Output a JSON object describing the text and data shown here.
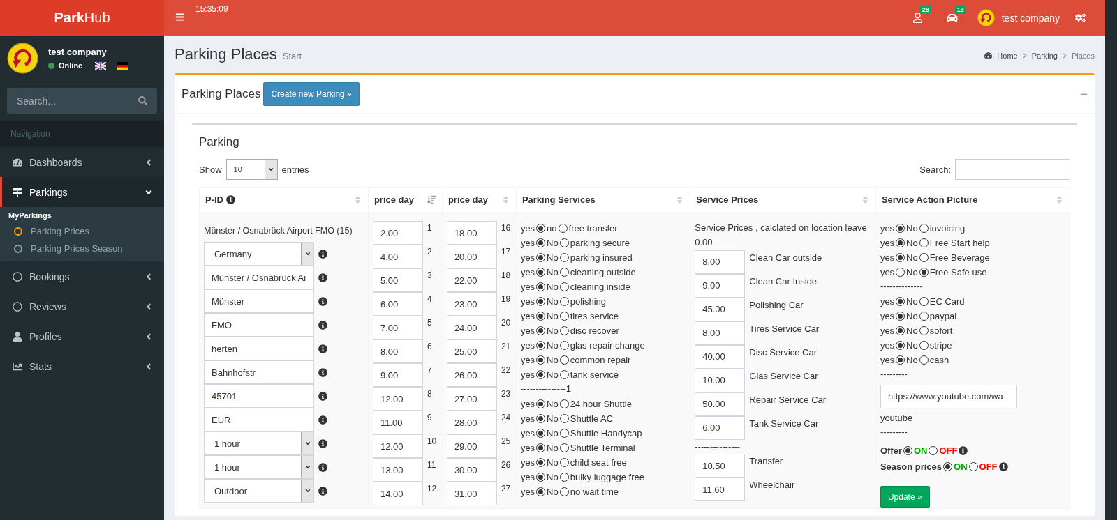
{
  "brand": {
    "bold": "Park",
    "light": "Hub"
  },
  "user": {
    "name": "test company",
    "status": "Online",
    "online": true
  },
  "sidebar": {
    "search_placeholder": "Search...",
    "section": "Navigation",
    "items": [
      {
        "kind": "dashboard",
        "label": "Dashboards",
        "expanded": false,
        "selected": false
      },
      {
        "kind": "signs",
        "label": "Parkings",
        "expanded": true,
        "selected": true,
        "heading": "MyParkings",
        "children": [
          {
            "label": "Parking Prices",
            "selected": true
          },
          {
            "label": "Parking Prices Season",
            "selected": false
          }
        ]
      },
      {
        "kind": "circle",
        "label": "Bookings",
        "expanded": false,
        "selected": false
      },
      {
        "kind": "circle",
        "label": "Reviews",
        "expanded": false,
        "selected": false
      },
      {
        "kind": "user",
        "label": "Profiles",
        "expanded": false,
        "selected": false
      },
      {
        "kind": "chart",
        "label": "Stats",
        "expanded": false,
        "selected": false
      }
    ]
  },
  "header": {
    "time": "15:35:09",
    "notifications": [
      {
        "kind": "user",
        "count": "28"
      },
      {
        "kind": "car",
        "count": "13"
      }
    ],
    "user_name": "test company"
  },
  "page": {
    "title": "Parking Places",
    "subtitle": "Start",
    "breadcrumb": [
      "Home",
      "Parking",
      "Places"
    ]
  },
  "box": {
    "title": "Parking Places",
    "button": "Create new Parking »"
  },
  "panel": {
    "title": "Parking",
    "show_label": "Show",
    "length": "10",
    "entries_label": "entries",
    "search_label": "Search:"
  },
  "columns": [
    {
      "label": "P-ID",
      "info": true,
      "sorted": false
    },
    {
      "label": "price day",
      "info": false,
      "sorted": true
    },
    {
      "label": "price day",
      "info": false,
      "sorted": false
    },
    {
      "label": "Parking Services",
      "info": false,
      "sorted": false
    },
    {
      "label": "Service Prices",
      "info": false,
      "sorted": false
    },
    {
      "label": "Service Action Picture",
      "info": false,
      "sorted": false
    }
  ],
  "pid": {
    "title": "Münster / Osnabrück Airport FMO (15)",
    "fields": [
      {
        "kind": "select",
        "value": "Germany"
      },
      {
        "kind": "text",
        "value": "Münster / Osnabrück Ai"
      },
      {
        "kind": "text",
        "value": "Münster"
      },
      {
        "kind": "text",
        "value": "FMO"
      },
      {
        "kind": "text",
        "value": "herten"
      },
      {
        "kind": "text",
        "value": "Bahnhofstr"
      },
      {
        "kind": "text",
        "value": "45701"
      },
      {
        "kind": "text",
        "value": "EUR"
      },
      {
        "kind": "select",
        "value": "1 hour"
      },
      {
        "kind": "select",
        "value": "1 hour"
      },
      {
        "kind": "select",
        "value": "Outdoor"
      }
    ]
  },
  "prices_a": [
    {
      "value": "2.00",
      "day": "1"
    },
    {
      "value": "4.00",
      "day": "2"
    },
    {
      "value": "5.00",
      "day": "3"
    },
    {
      "value": "6.00",
      "day": "4"
    },
    {
      "value": "7.00",
      "day": "5"
    },
    {
      "value": "8.00",
      "day": "6"
    },
    {
      "value": "9.00",
      "day": "7"
    },
    {
      "value": "12.00",
      "day": "8"
    },
    {
      "value": "11.00",
      "day": "9"
    },
    {
      "value": "12.00",
      "day": "10"
    },
    {
      "value": "13.00",
      "day": "11"
    },
    {
      "value": "14.00",
      "day": "12"
    }
  ],
  "prices_b": [
    {
      "value": "18.00",
      "day": "16"
    },
    {
      "value": "20.00",
      "day": "17"
    },
    {
      "value": "22.00",
      "day": "18"
    },
    {
      "value": "23.00",
      "day": "19"
    },
    {
      "value": "24.00",
      "day": "20"
    },
    {
      "value": "25.00",
      "day": "21"
    },
    {
      "value": "26.00",
      "day": "22"
    },
    {
      "value": "27.00",
      "day": "23"
    },
    {
      "value": "28.00",
      "day": "24"
    },
    {
      "value": "29.00",
      "day": "25"
    },
    {
      "value": "30.00",
      "day": "26"
    },
    {
      "value": "31.00",
      "day": "27"
    }
  ],
  "services": [
    {
      "kind": "option",
      "yes_text": "yes",
      "no_text": "no",
      "label": "free transfer",
      "yes": true
    },
    {
      "kind": "option",
      "yes_text": "yes",
      "no_text": "No",
      "label": "parking secure",
      "yes": true
    },
    {
      "kind": "option",
      "yes_text": "yes",
      "no_text": "No",
      "label": "parking insured",
      "yes": true
    },
    {
      "kind": "option",
      "yes_text": "yes",
      "no_text": "No",
      "label": "cleaning outside",
      "yes": true
    },
    {
      "kind": "option",
      "yes_text": "yes",
      "no_text": "No",
      "label": "cleaning inside",
      "yes": true
    },
    {
      "kind": "option",
      "yes_text": "yes",
      "no_text": "No",
      "label": "polishing",
      "yes": true
    },
    {
      "kind": "option",
      "yes_text": "yes",
      "no_text": "No",
      "label": "tires service",
      "yes": true
    },
    {
      "kind": "option",
      "yes_text": "yes",
      "no_text": "No",
      "label": "disc recover",
      "yes": true
    },
    {
      "kind": "option",
      "yes_text": "yes",
      "no_text": "No",
      "label": "glas repair change",
      "yes": true
    },
    {
      "kind": "option",
      "yes_text": "yes",
      "no_text": "No",
      "label": "common repair",
      "yes": true
    },
    {
      "kind": "option",
      "yes_text": "yes",
      "no_text": "No",
      "label": "tank service",
      "yes": true
    },
    {
      "kind": "separator",
      "text": "---------------1"
    },
    {
      "kind": "option",
      "yes_text": "yes",
      "no_text": "No",
      "label": "24 hour Shuttle",
      "yes": true
    },
    {
      "kind": "option",
      "yes_text": "yes",
      "no_text": "No",
      "label": "Shuttle AC",
      "yes": true
    },
    {
      "kind": "option",
      "yes_text": "yes",
      "no_text": "No",
      "label": "Shuttle Handycap",
      "yes": true
    },
    {
      "kind": "option",
      "yes_text": "yes",
      "no_text": "No",
      "label": "Shuttle Terminal",
      "yes": true
    },
    {
      "kind": "option",
      "yes_text": "yes",
      "no_text": "No",
      "label": "child seat free",
      "yes": true
    },
    {
      "kind": "option",
      "yes_text": "yes",
      "no_text": "No",
      "label": "bulky luggage free",
      "yes": true
    },
    {
      "kind": "option",
      "yes_text": "yes",
      "no_text": "No",
      "label": "no wait time",
      "yes": true
    }
  ],
  "service_prices": {
    "note": "Service Prices , calclated on location leave",
    "total": "0.00",
    "items": [
      {
        "kind": "price",
        "value": "8.00",
        "label": "Clean Car outside"
      },
      {
        "kind": "price",
        "value": "9.00",
        "label": "Clean Car Inside"
      },
      {
        "kind": "price",
        "value": "45.00",
        "label": "Polishing Car"
      },
      {
        "kind": "price",
        "value": "8.00",
        "label": "Tires Service Car"
      },
      {
        "kind": "price",
        "value": "40.00",
        "label": "Disc Service Car"
      },
      {
        "kind": "price",
        "value": "10.00",
        "label": "Glas Service Car"
      },
      {
        "kind": "price",
        "value": "50.00",
        "label": "Repair Service Car"
      },
      {
        "kind": "price",
        "value": "6.00",
        "label": "Tank Service Car"
      },
      {
        "kind": "separator",
        "text": "---------------"
      },
      {
        "kind": "price",
        "value": "10.50",
        "label": "Transfer"
      },
      {
        "kind": "price",
        "value": "11.60",
        "label": "Wheelchair"
      }
    ]
  },
  "action": {
    "items": [
      {
        "kind": "option",
        "yes_text": "yes",
        "no_text": "No",
        "label": "invoicing",
        "yes": true
      },
      {
        "kind": "option",
        "yes_text": "yes",
        "no_text": "No",
        "label": "Free Start help",
        "yes": true
      },
      {
        "kind": "option",
        "yes_text": "yes",
        "no_text": "No",
        "label": "Free Beverage",
        "yes": true
      },
      {
        "kind": "option",
        "yes_text": "yes",
        "no_text": "No",
        "label": "Free Safe use",
        "yes": false
      },
      {
        "kind": "separator",
        "text": "--------------"
      },
      {
        "kind": "option",
        "yes_text": "yes",
        "no_text": "No",
        "label": "EC Card",
        "yes": true
      },
      {
        "kind": "option",
        "yes_text": "yes",
        "no_text": "No",
        "label": "paypal",
        "yes": true
      },
      {
        "kind": "option",
        "yes_text": "yes",
        "no_text": "No",
        "label": "sofort",
        "yes": true
      },
      {
        "kind": "option",
        "yes_text": "yes",
        "no_text": "No",
        "label": "stripe",
        "yes": true
      },
      {
        "kind": "option",
        "yes_text": "yes",
        "no_text": "No",
        "label": "cash",
        "yes": true
      },
      {
        "kind": "separator",
        "text": "---------"
      },
      {
        "kind": "field",
        "value": "https://www.youtube.com/wa"
      },
      {
        "kind": "caption",
        "text": "youtube"
      },
      {
        "kind": "separator",
        "text": "---------"
      }
    ],
    "toggles": [
      {
        "label": "Offer",
        "on_text": "ON",
        "off_text": "OFF",
        "on": true
      },
      {
        "label": "Season prices",
        "on_text": "ON",
        "off_text": "OFF",
        "on": true
      }
    ],
    "button": "Update »"
  }
}
